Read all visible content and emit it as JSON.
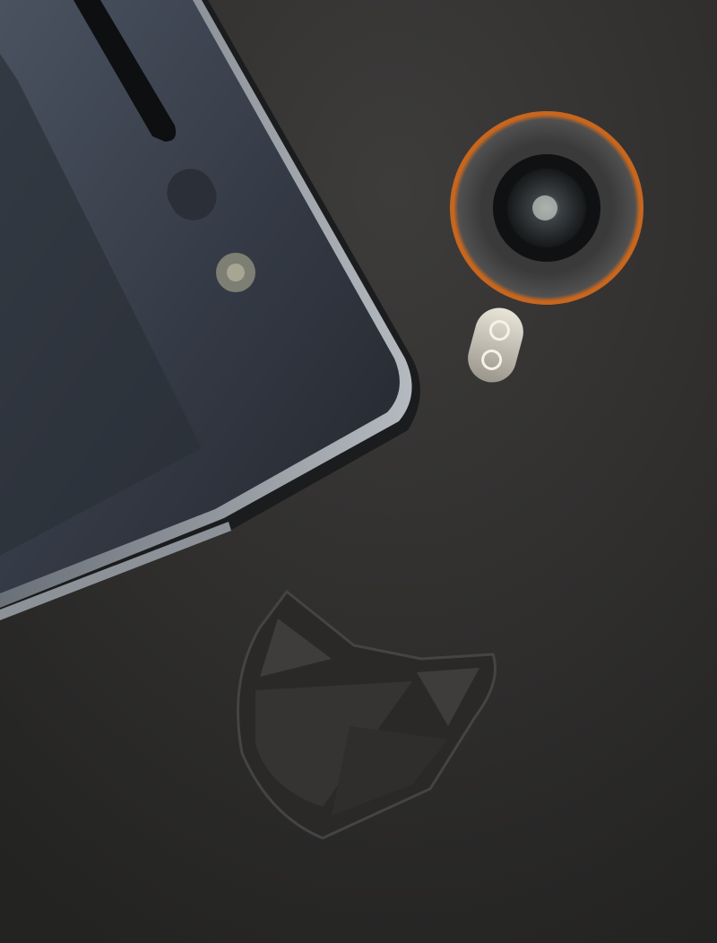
{
  "scene": {
    "subject": "phone-front-and-back",
    "colors": {
      "back_surface": "#2e2d2c",
      "back_surface_light": "#3a3938",
      "screen_glass": "#3c4350",
      "phone_frame": "#9aa0a8",
      "camera_ring": "#c8661e",
      "flash": "#d8d4c8",
      "logo_emboss": "#3b3a39"
    }
  }
}
